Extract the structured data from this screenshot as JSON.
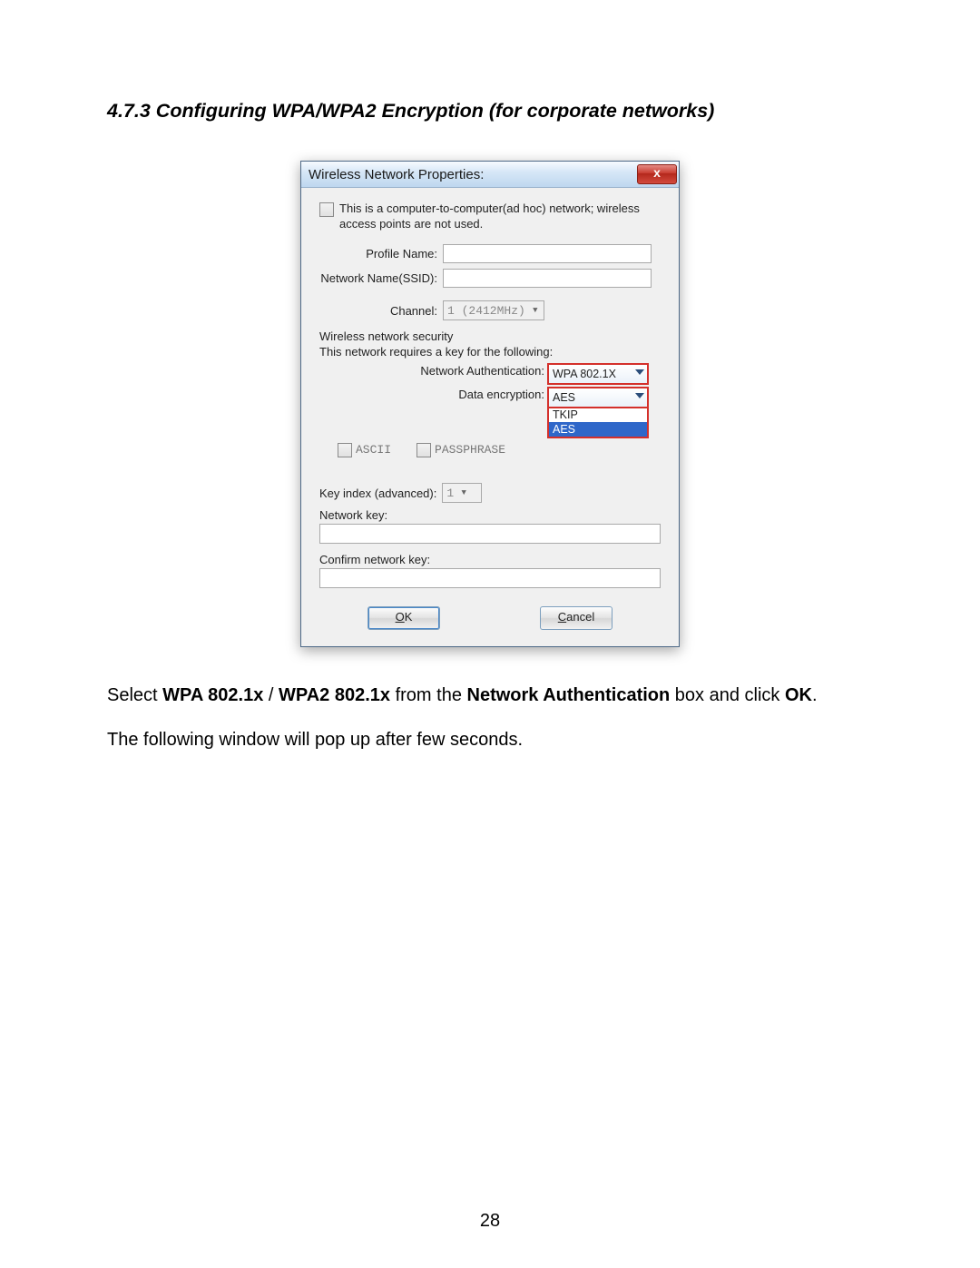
{
  "heading": "4.7.3 Configuring WPA/WPA2 Encryption (for corporate networks)",
  "dialog": {
    "title": "Wireless Network Properties:",
    "adhoc_text": "This is a computer-to-computer(ad hoc) network; wireless access points are not used.",
    "profile_label": "Profile Name:",
    "ssid_label": "Network Name(SSID):",
    "channel_label": "Channel:",
    "channel_value": "1 (2412MHz)",
    "security_group": "Wireless network security",
    "security_sub": "This network requires a key for the following:",
    "auth_label": "Network Authentication:",
    "auth_value": "WPA 802.1X",
    "enc_label": "Data encryption:",
    "enc_value": "AES",
    "enc_options": {
      "tkip": "TKIP",
      "aes": "AES"
    },
    "ascii_label": "ASCII",
    "passphrase_label": "PASSPHRASE",
    "key_index_label": "Key index (advanced):",
    "key_index_value": "1",
    "network_key_label": "Network key:",
    "confirm_key_label": "Confirm network key:",
    "ok_u": "O",
    "ok_rest": "K",
    "cancel_u": "C",
    "cancel_rest": "ancel"
  },
  "para1_a": "Select ",
  "para1_b": "WPA 802.1x",
  "para1_c": " / ",
  "para1_d": "WPA2 802.1x",
  "para1_e": " from the ",
  "para1_f": "Network Authentication",
  "para1_g": " box and click ",
  "para1_h": "OK",
  "para1_i": ".",
  "para2": "The following window will pop up after few seconds.",
  "page_number": "28"
}
